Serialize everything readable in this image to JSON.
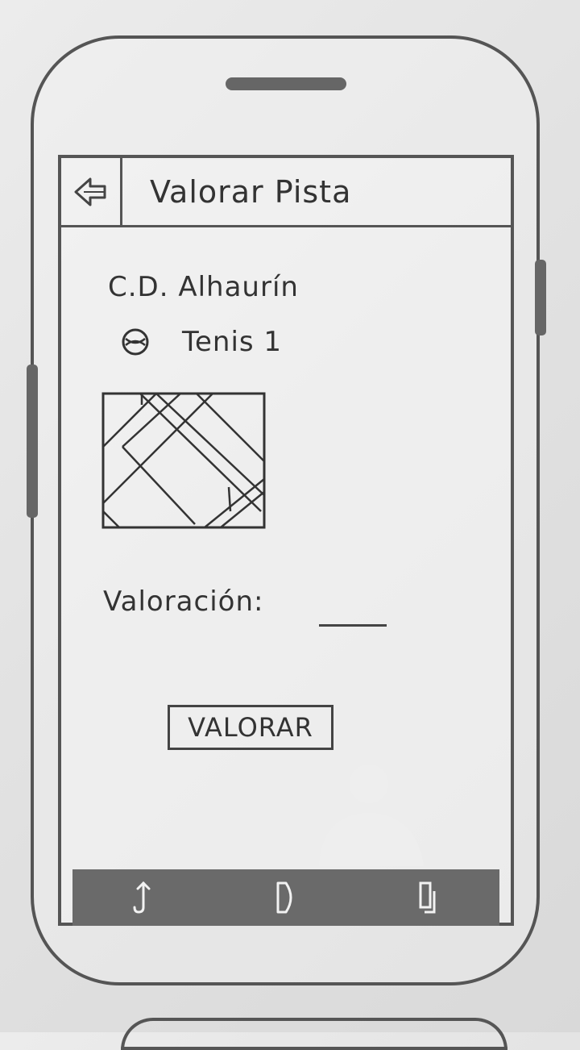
{
  "appbar": {
    "title": "Valorar Pista",
    "back_icon": "arrow-left-icon"
  },
  "court": {
    "club_name": "C.D. Alhaurín",
    "sport_icon": "tennis-ball-icon",
    "court_name": "Tenis 1"
  },
  "rating": {
    "label": "Valoración:",
    "value": "",
    "placeholder": ""
  },
  "actions": {
    "submit_label": "VALORAR"
  },
  "navbar": {
    "icons": [
      "back-nav-icon",
      "home-nav-icon",
      "recent-apps-icon"
    ]
  },
  "colors": {
    "sketch_line": "#555555",
    "navbar_bg": "#6a6a6a",
    "paper": "#e6e6e6"
  }
}
